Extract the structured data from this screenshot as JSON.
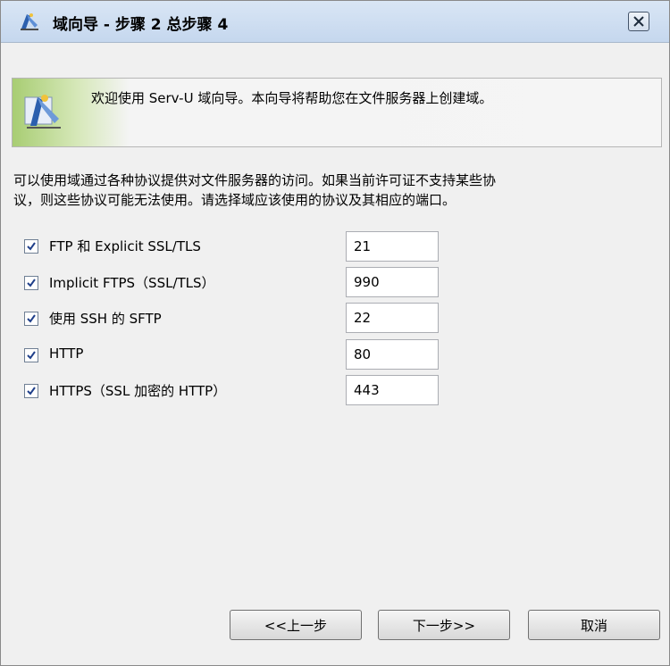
{
  "window": {
    "title": "域向导 - 步骤 2 总步骤 4"
  },
  "banner": {
    "text": "欢迎使用 Serv-U 域向导。本向导将帮助您在文件服务器上创建域。"
  },
  "description": {
    "line1": "可以使用域通过各种协议提供对文件服务器的访问。如果当前许可证不支持某些协",
    "line2": "议，则这些协议可能无法使用。请选择域应该使用的协议及其相应的端口。"
  },
  "protocols": [
    {
      "label": "FTP 和 Explicit SSL/TLS",
      "port": "21",
      "checked": true
    },
    {
      "label": "Implicit FTPS（SSL/TLS）",
      "port": "990",
      "checked": true
    },
    {
      "label": "使用 SSH 的 SFTP",
      "port": "22",
      "checked": true
    },
    {
      "label": "HTTP",
      "port": "80",
      "checked": true
    },
    {
      "label": "HTTPS（SSL 加密的 HTTP）",
      "port": "443",
      "checked": true
    }
  ],
  "buttons": {
    "back": "<<上一步",
    "next": "下一步>>",
    "cancel": "取消"
  },
  "icons": {
    "app": "wizard-icon",
    "banner": "wizard-icon",
    "close": "close-icon",
    "check": "checkmark-icon"
  }
}
